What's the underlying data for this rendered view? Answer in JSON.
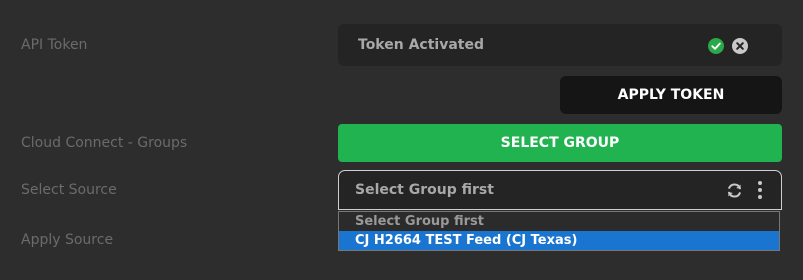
{
  "rows": {
    "api_token": {
      "label": "API Token",
      "value": "Token Activated"
    },
    "apply_token": {
      "button_label": "APPLY TOKEN"
    },
    "cloud_connect": {
      "label": "Cloud Connect - Groups",
      "button_label": "SELECT GROUP"
    },
    "select_source": {
      "label": "Select Source",
      "value": "Select Group first",
      "options": [
        "Select Group first",
        "CJ H2664 TEST Feed (CJ Texas)"
      ],
      "highlighted_index": 1
    },
    "apply_source": {
      "label": "Apply Source"
    }
  },
  "colors": {
    "background": "#2d2d2d",
    "field_background": "#242424",
    "accent_green": "#21b350",
    "status_green": "#2aa84a",
    "dropdown_highlight": "#1a75d0"
  },
  "icons": {
    "token_status": "check-circle-icon",
    "token_clear": "close-circle-icon",
    "source_refresh": "refresh-icon",
    "source_menu": "kebab-menu-icon"
  }
}
